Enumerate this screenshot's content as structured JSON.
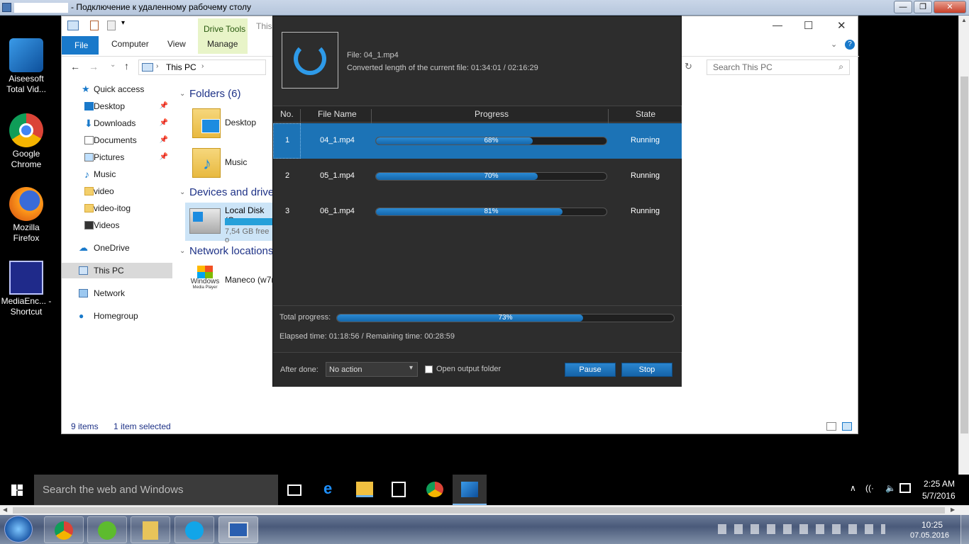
{
  "rdp": {
    "title": "- Подключение к удаленному рабочему столу",
    "btn_min": "—",
    "btn_max": "❐",
    "btn_close": "✕"
  },
  "desktop_icons": [
    {
      "label": "Aiseesoft Total Vid...",
      "color": "#1b6fc0"
    },
    {
      "label": "Google Chrome",
      "color": "#e0a020"
    },
    {
      "label": "Mozilla Firefox",
      "color": "#e86a1a"
    },
    {
      "label": "MediaEnc... - Shortcut",
      "color": "#3b4fb0"
    }
  ],
  "explorer": {
    "title_partial": "This",
    "ribbon": {
      "file": "File",
      "computer": "Computer",
      "view": "View",
      "drive_tools": "Drive Tools",
      "manage": "Manage"
    },
    "window": {
      "min": "—",
      "max": "☐",
      "close": "✕"
    },
    "address": {
      "crumb": "This PC",
      "sep1": "›",
      "sep2": "›"
    },
    "search_placeholder": "Search This PC",
    "nav": {
      "quick_access": "Quick access",
      "items": [
        "Desktop",
        "Downloads",
        "Documents",
        "Pictures",
        "Music",
        "video",
        "video-itog",
        "Videos"
      ],
      "onedrive": "OneDrive",
      "this_pc": "This PC",
      "network": "Network",
      "homegroup": "Homegroup"
    },
    "sections": {
      "folders": "Folders (6)",
      "devices": "Devices and drive",
      "network": "Network locations"
    },
    "folders": [
      "Desktop",
      "Music"
    ],
    "drive": {
      "name": "Local Disk (C",
      "free": "7,54 GB free o"
    },
    "netloc": {
      "name": "Maneco (w7r",
      "logo": "Windows",
      "logo_sub": "Media Player"
    },
    "status": {
      "items": "9 items",
      "selected": "1 item selected"
    }
  },
  "converter": {
    "file_line": "File: 04_1.mp4",
    "converted_line": "Converted length of the current file: 01:34:01 / 02:16:29",
    "headers": {
      "no": "No.",
      "file": "File Name",
      "progress": "Progress",
      "state": "State"
    },
    "rows": [
      {
        "no": "1",
        "file": "04_1.mp4",
        "progress": 68,
        "progress_label": "68%",
        "state": "Running"
      },
      {
        "no": "2",
        "file": "05_1.mp4",
        "progress": 70,
        "progress_label": "70%",
        "state": "Running"
      },
      {
        "no": "3",
        "file": "06_1.mp4",
        "progress": 81,
        "progress_label": "81%",
        "state": "Running"
      }
    ],
    "total_label": "Total progress:",
    "total": 73,
    "total_label_pct": "73%",
    "elapsed": "Elapsed time: 01:18:56 / Remaining time: 00:28:59",
    "after_done_label": "After done:",
    "after_done_value": "No action",
    "open_output": "Open output folder",
    "pause": "Pause",
    "stop": "Stop"
  },
  "taskbar10": {
    "search": "Search the web and Windows",
    "time": "2:25 AM",
    "date": "5/7/2016"
  },
  "taskbar7": {
    "time": "10:25",
    "date": "07.05.2016"
  },
  "colors": {
    "accent": "#1c73b6",
    "dialog_bg": "#2d2d2d"
  }
}
